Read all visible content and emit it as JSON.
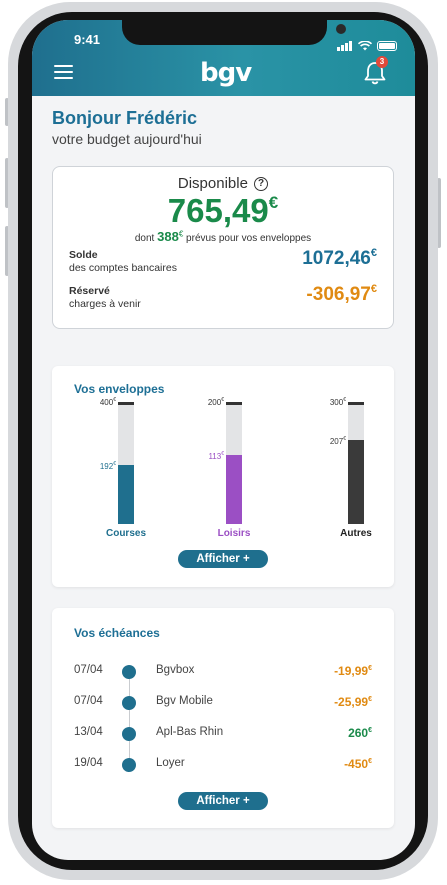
{
  "status_bar": {
    "time": "9:41"
  },
  "header": {
    "logo_text": "bgv",
    "notification_count": "3"
  },
  "greeting": {
    "title": "Bonjour Frédéric",
    "subtitle": "votre budget aujourd'hui"
  },
  "available": {
    "label": "Disponible",
    "help_symbol": "?",
    "amount": "765,49",
    "currency": "€",
    "note_prefix": "dont",
    "note_amount": "388",
    "note_suffix": "prévus pour vos enveloppes",
    "balance_label": "Solde",
    "balance_sublabel": "des comptes bancaires",
    "balance_amount": "1072,46",
    "reserved_label": "Réservé",
    "reserved_sublabel": "charges à venir",
    "reserved_amount": "-306,97"
  },
  "envelopes": {
    "title": "Vos enveloppes",
    "items": [
      {
        "name": "Courses",
        "total": "400",
        "spent": "192",
        "spent_value": 192,
        "total_value": 400,
        "color": "#1f6f8e"
      },
      {
        "name": "Loisirs",
        "total": "200",
        "spent": "113",
        "spent_value": 113,
        "total_value": 200,
        "color": "#9b4fc4"
      },
      {
        "name": "Autres",
        "total": "300",
        "spent": "207",
        "spent_value": 207,
        "total_value": 300,
        "color": "#3a3a3a"
      }
    ],
    "button_label": "Afficher +"
  },
  "due": {
    "title": "Vos échéances",
    "items": [
      {
        "date": "07/04",
        "label": "Bgvbox",
        "amount": "-19,99",
        "color": "#e08a12"
      },
      {
        "date": "07/04",
        "label": "Bgv Mobile",
        "amount": "-25,99",
        "color": "#e08a12"
      },
      {
        "date": "13/04",
        "label": "Apl-Bas Rhin",
        "amount": "260",
        "color": "#1a8a4a"
      },
      {
        "date": "19/04",
        "label": "Loyer",
        "amount": "-450",
        "color": "#e08a12"
      }
    ],
    "button_label": "Afficher +"
  },
  "colors": {
    "primary": "#1f6f8e",
    "positive": "#1a8a4a",
    "negative": "#e08a12",
    "balance": "#1d6f95"
  }
}
